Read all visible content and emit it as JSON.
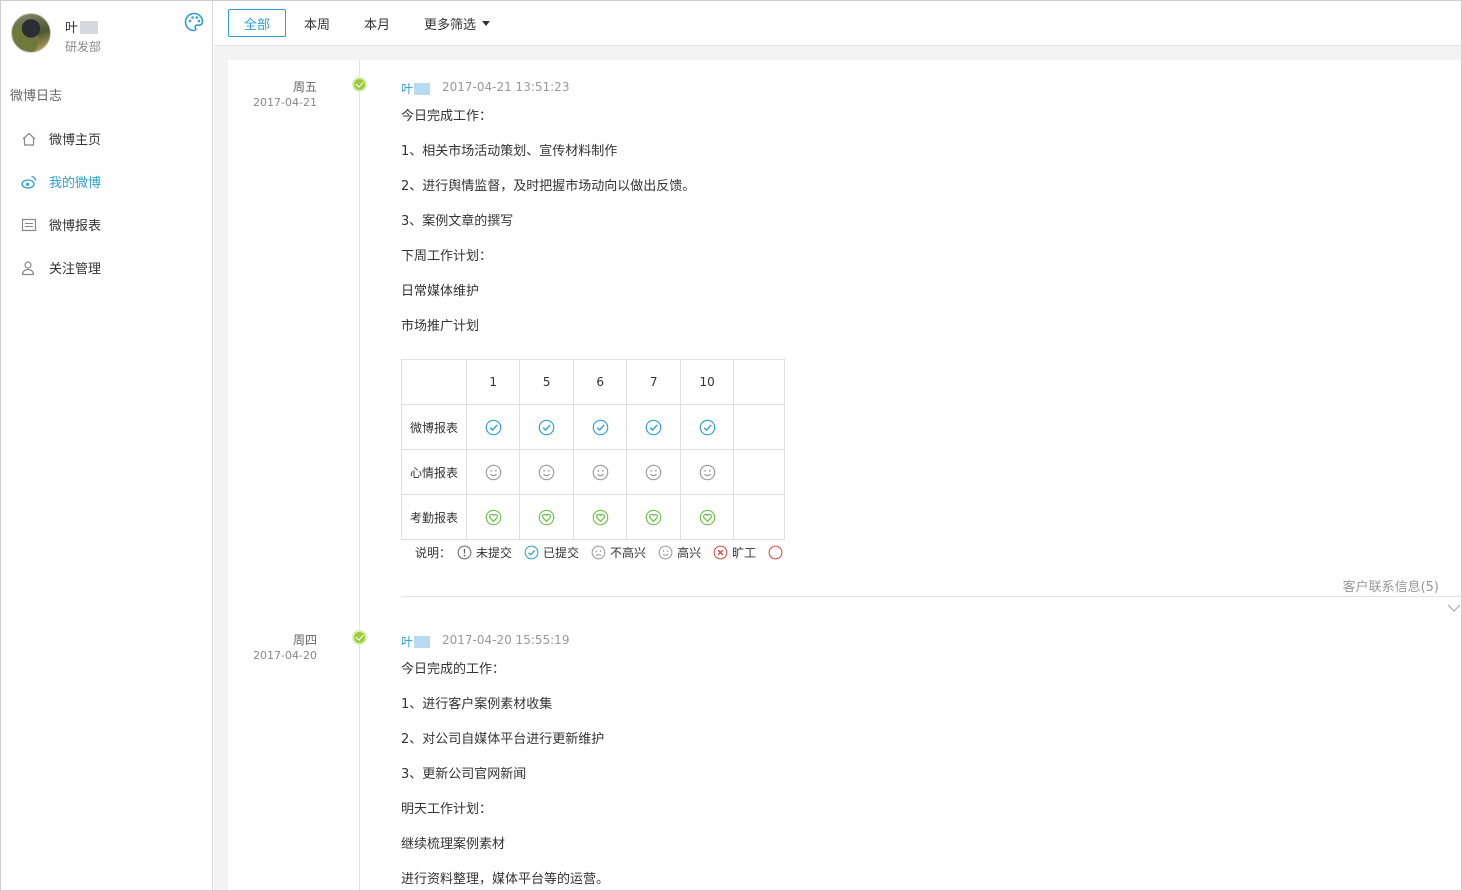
{
  "user": {
    "name": "叶",
    "department": "研发部"
  },
  "sidebar": {
    "section_title": "微博日志",
    "items": [
      {
        "label": "微博主页",
        "icon": "home-icon",
        "active": false
      },
      {
        "label": "我的微博",
        "icon": "weibo-icon",
        "active": true
      },
      {
        "label": "微博报表",
        "icon": "report-icon",
        "active": false
      },
      {
        "label": "关注管理",
        "icon": "user-follow-icon",
        "active": false
      }
    ]
  },
  "filters": {
    "all": "全部",
    "this_week": "本周",
    "this_month": "本月",
    "more": "更多筛选"
  },
  "colors": {
    "accent": "#2a9fd8",
    "submitted": "#2a9fd8",
    "attendance": "#6cc24a",
    "timeline_dot": "#9ccc3c"
  },
  "entries": [
    {
      "weekday": "周五",
      "date": "2017-04-21",
      "author": "叶",
      "timestamp": "2017-04-21 13:51:23",
      "lines": [
        "今日完成工作：",
        "1、相关市场活动策划、宣传材料制作",
        "2、进行舆情监督，及时把握市场动向以做出反馈。",
        "3、案例文章的撰写",
        "下周工作计划：",
        "日常媒体维护",
        "市场推广计划"
      ],
      "report_table": {
        "columns": [
          "1",
          "5",
          "6",
          "7",
          "10"
        ],
        "rows": [
          {
            "label": "微博报表",
            "icon": "submitted-check-icon"
          },
          {
            "label": "心情报表",
            "icon": "smile-icon"
          },
          {
            "label": "考勤报表",
            "icon": "heart-icon"
          }
        ]
      },
      "legend": {
        "prefix": "说明：",
        "items": [
          {
            "label": "未提交",
            "icon": "not-submitted-icon"
          },
          {
            "label": "已提交",
            "icon": "submitted-check-icon"
          },
          {
            "label": "不高兴",
            "icon": "sad-icon"
          },
          {
            "label": "高兴",
            "icon": "smile-icon"
          },
          {
            "label": "旷工",
            "icon": "absent-x-icon"
          }
        ]
      },
      "contact_info": "客户联系信息(5)"
    },
    {
      "weekday": "周四",
      "date": "2017-04-20",
      "author": "叶",
      "timestamp": "2017-04-20 15:55:19",
      "lines": [
        "今日完成的工作：",
        "1、进行客户案例素材收集",
        "2、对公司自媒体平台进行更新维护",
        "3、更新公司官网新闻",
        "明天工作计划：",
        "继续梳理案例素材",
        "进行资料整理，媒体平台等的运营。"
      ]
    }
  ]
}
